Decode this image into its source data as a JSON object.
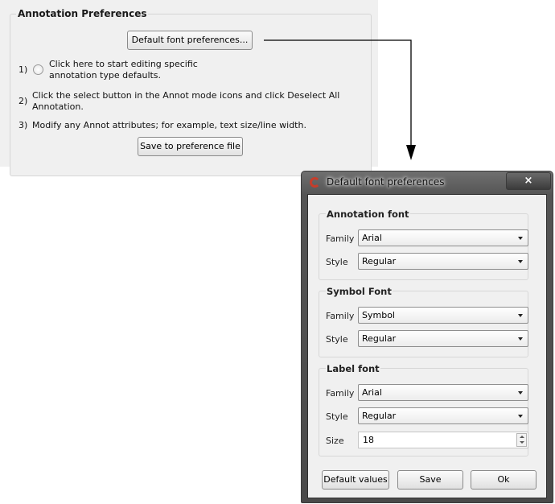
{
  "prefs_panel": {
    "group_title": "Annotation Preferences",
    "default_font_button": "Default font preferences...",
    "steps": [
      {
        "num": "1)",
        "text_lines": [
          "Click here to start editing specific",
          "annotation type defaults."
        ]
      },
      {
        "num": "2)",
        "text_lines": [
          "Click the select button in the Annot mode icons and click Deselect All",
          "Annotation."
        ]
      },
      {
        "num": "3)",
        "text_lines": [
          "Modify any Annot attributes; for example, text size/line width."
        ]
      }
    ],
    "save_button": "Save to preference file"
  },
  "dialog": {
    "title": "Default font preferences",
    "close_glyph": "×",
    "icon": "app-logo-icon",
    "annotation_font": {
      "title": "Annotation font",
      "family_label": "Family",
      "family_value": "Arial",
      "style_label": "Style",
      "style_value": "Regular"
    },
    "symbol_font": {
      "title": "Symbol Font",
      "family_label": "Family",
      "family_value": "Symbol",
      "style_label": "Style",
      "style_value": "Regular"
    },
    "label_font": {
      "title": "Label font",
      "family_label": "Family",
      "family_value": "Arial",
      "style_label": "Style",
      "style_value": "Regular",
      "size_label": "Size",
      "size_value": "18"
    },
    "buttons": {
      "default_values": "Default values",
      "save": "Save",
      "ok": "Ok"
    }
  }
}
